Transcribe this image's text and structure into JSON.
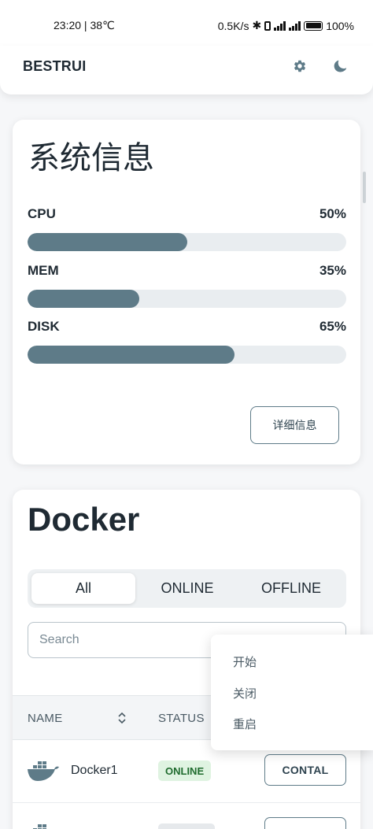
{
  "status_bar": {
    "time_temp": "23:20 | 38℃",
    "net_speed": "0.5K/s",
    "battery": "100%"
  },
  "app": {
    "title": "BESTRUI",
    "icons": [
      "gear-icon",
      "moon-icon"
    ]
  },
  "system_info": {
    "title": "系统信息",
    "metrics": [
      {
        "label": "CPU",
        "value": "50%",
        "percent": 50
      },
      {
        "label": "MEM",
        "value": "35%",
        "percent": 35
      },
      {
        "label": "DISK",
        "value": "65%",
        "percent": 65
      }
    ],
    "detail_button": "详细信息"
  },
  "docker": {
    "title": "Docker",
    "tabs": [
      {
        "label": "All",
        "active": true
      },
      {
        "label": "ONLINE",
        "active": false
      },
      {
        "label": "OFFLINE",
        "active": false
      }
    ],
    "search_placeholder": "Search",
    "columns": {
      "name": "NAME",
      "status": "STATUS"
    },
    "rows": [
      {
        "name": "Docker1",
        "status": "ONLINE",
        "action": "CONTAL"
      },
      {
        "name": "",
        "status": "",
        "action": ""
      }
    ]
  },
  "context_menu": {
    "items": [
      "开始",
      "关闭",
      "重启"
    ]
  },
  "colors": {
    "accent": "#5e7b88",
    "track": "#e9edf0",
    "online_bg": "#dff3e1",
    "online_text": "#1f6b2e"
  }
}
